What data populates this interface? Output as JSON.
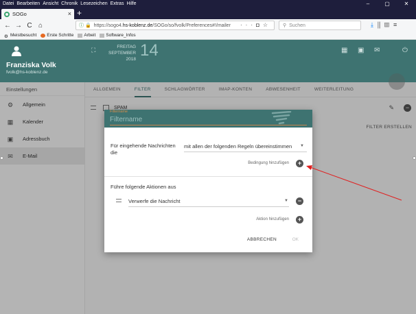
{
  "menubar": [
    "Datei",
    "Bearbeiten",
    "Ansicht",
    "Chronik",
    "Lesezeichen",
    "Extras",
    "Hilfe"
  ],
  "window_controls": [
    "–",
    "▢",
    "✕"
  ],
  "tab": {
    "title": "SOGo",
    "close": "×",
    "new": "+"
  },
  "nav": {
    "back": "←",
    "forward": "→",
    "reload": "C",
    "home": "⌂",
    "url_prefix": "https://sogo4.",
    "url_host": "hs-koblenz.de",
    "url_path": "/SOGo/so/fvolk/Preferences#!/mailer",
    "search_placeholder": "Suchen"
  },
  "bookmarks": [
    "Meistbesucht",
    "Erste Schritte",
    "Arbeit",
    "Software_Infos"
  ],
  "user": {
    "name": "Franziska Volk",
    "email": "fvolk@hs-koblenz.de"
  },
  "date": {
    "weekday": "FREITAG",
    "month": "SEPTEMBER",
    "year": "2018",
    "day": "14"
  },
  "sidebar": {
    "header": "Einstellungen",
    "items": [
      {
        "label": "Allgemein",
        "icon": "gear-icon"
      },
      {
        "label": "Kalender",
        "icon": "calendar-icon"
      },
      {
        "label": "Adressbuch",
        "icon": "contacts-icon"
      },
      {
        "label": "E-Mail",
        "icon": "mail-icon",
        "active": true
      }
    ]
  },
  "tabs": [
    "ALLGEMEIN",
    "FILTER",
    "SCHLAGWÖRTER",
    "IMAP-KONTEN",
    "ABWESENHEIT",
    "WEITERLEITUNG"
  ],
  "active_tab": "FILTER",
  "filter_list": [
    {
      "label": "SPAM"
    }
  ],
  "create_filter": "FILTER ERSTELLEN",
  "dialog": {
    "field_label": "Filtername",
    "placeholder": "Filtername",
    "incoming_label": "Für eingehende Nachrichten die",
    "match_select": "mit allen der folgenden Regeln übereinstimmen",
    "add_condition": "Bedingung hinzufügen",
    "actions_header": "Führe folgende Aktionen aus",
    "action_select": "Verwerfe die Nachricht",
    "add_action": "Aktion hinzufügen",
    "cancel": "ABBRECHEN",
    "ok": "OK"
  },
  "annotation_color": "#e02020"
}
